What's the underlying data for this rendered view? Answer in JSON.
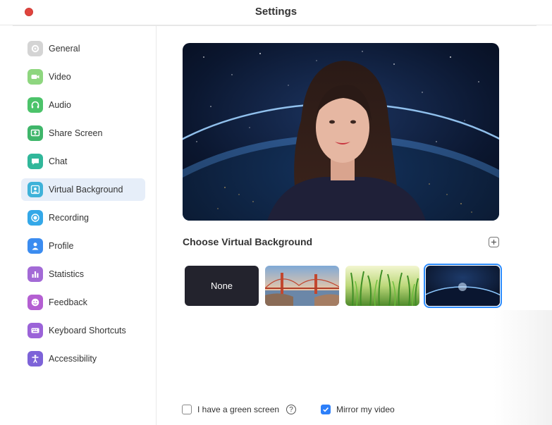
{
  "window": {
    "title": "Settings",
    "close_color": "#e0443e"
  },
  "sidebar": {
    "active_item": "Virtual Background",
    "items": [
      {
        "label": "General",
        "icon": "gear-icon",
        "color": "#c9c9c9"
      },
      {
        "label": "Video",
        "icon": "video-camera-icon",
        "color": "#8ed67f"
      },
      {
        "label": "Audio",
        "icon": "headphones-icon",
        "color": "#4cc36a"
      },
      {
        "label": "Share Screen",
        "icon": "share-screen-icon",
        "color": "#3fb66a"
      },
      {
        "label": "Chat",
        "icon": "chat-bubble-icon",
        "color": "#31b79a"
      },
      {
        "label": "Virtual Background",
        "icon": "person-frame-icon",
        "color": "#3fb2d9"
      },
      {
        "label": "Recording",
        "icon": "record-icon",
        "color": "#34a8e8"
      },
      {
        "label": "Profile",
        "icon": "profile-icon",
        "color": "#3b8cf0"
      },
      {
        "label": "Statistics",
        "icon": "bar-chart-icon",
        "color": "#a36ad6"
      },
      {
        "label": "Feedback",
        "icon": "smiley-icon",
        "color": "#b45fd2"
      },
      {
        "label": "Keyboard Shortcuts",
        "icon": "keyboard-icon",
        "color": "#9b63d8"
      },
      {
        "label": "Accessibility",
        "icon": "accessibility-icon",
        "color": "#7d63d8"
      }
    ]
  },
  "main": {
    "section_title": "Choose Virtual Background",
    "add_icon": "plus-square-icon",
    "backgrounds": [
      {
        "label": "None",
        "name": "background-none"
      },
      {
        "label": "",
        "name": "background-golden-gate"
      },
      {
        "label": "",
        "name": "background-grass"
      },
      {
        "label": "",
        "name": "background-earth-space",
        "selected": true
      }
    ],
    "green_screen": {
      "label": "I have a green screen",
      "checked": false
    },
    "mirror": {
      "label": "Mirror my video",
      "checked": true
    },
    "accent_color": "#2d8cff"
  }
}
